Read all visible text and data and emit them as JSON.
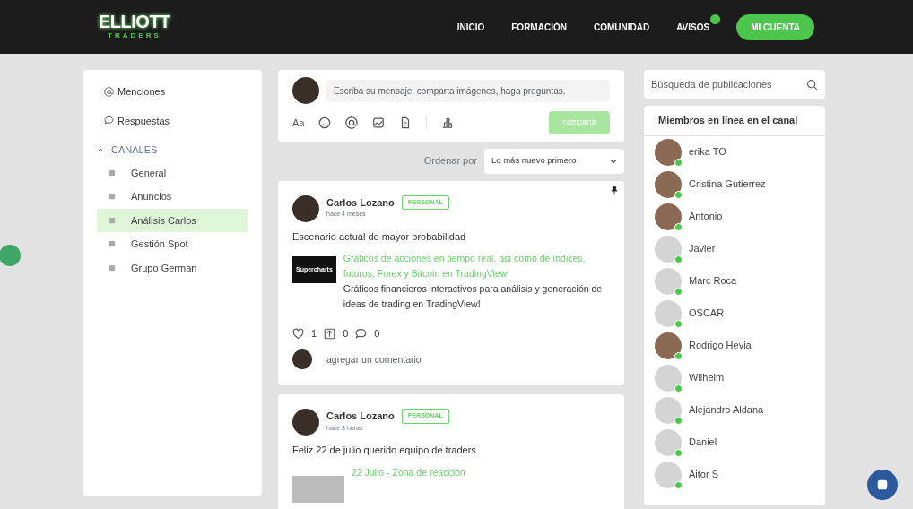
{
  "header": {
    "logo_top": "ELLIOTT",
    "logo_bottom": "TRADERS",
    "nav": [
      {
        "label": "INICIO",
        "kind": "plain"
      },
      {
        "label": "FORMACIÓN",
        "kind": "plain"
      },
      {
        "label": "COMUNIDAD",
        "kind": "plain"
      },
      {
        "label": "AVISOS",
        "kind": "badge"
      }
    ],
    "account": "MI CUENTA"
  },
  "sidebar": {
    "items": [
      {
        "label": "Menciones"
      },
      {
        "label": "Respuestas"
      }
    ],
    "section": {
      "label": "CANALES",
      "expanded": true
    },
    "channels": [
      {
        "label": "General",
        "selected": false
      },
      {
        "label": "Anuncios",
        "selected": false
      },
      {
        "label": "Análisis Carlos",
        "selected": true
      },
      {
        "label": "Gestión Spot",
        "selected": false
      },
      {
        "label": "Grupo German",
        "selected": false
      }
    ]
  },
  "composer": {
    "placeholder": "Escriba su mensaje, comparta imágenes, haga preguntas.",
    "format_label": "Aa",
    "submit": "compartir",
    "disabled": true
  },
  "sort": {
    "label": "Ordenar por",
    "value": "Lo más nuevo primero"
  },
  "posts": [
    {
      "author": "Carlos Lozano",
      "tag": "PERSONAL",
      "time": "hace 4 meses",
      "pinned": true,
      "text": "Escenario actual de mayor probabilidad",
      "link_title": "Gráficos de acciones en tiempo real, así como de índices, futuros, Forex y Bitcoin en TradingView",
      "link_desc": "Gráficos financieros interactivos para análisis y generación de ideas de trading en TradingView!",
      "thumb_label": "Supercharts",
      "likes": "1",
      "shares": "0",
      "comments": "0",
      "comment_placeholder": "agregar un comentario"
    },
    {
      "author": "Carlos Lozano",
      "tag": "PERSONAL",
      "time": "hace 3 horas",
      "pinned": false,
      "text": "Feliz 22 de julio querido equipo de traders",
      "link_title": "22 Julio - Zona de reacción"
    }
  ],
  "search": {
    "placeholder": "Búsqueda de publicaciones"
  },
  "members": {
    "title": "Miembros en línea en el canal",
    "items": [
      {
        "name": "erika TO",
        "kind": "photo",
        "online": true
      },
      {
        "name": "Cristina Gutierrez",
        "kind": "photo",
        "online": true
      },
      {
        "name": "Antonio",
        "kind": "photo",
        "online": true
      },
      {
        "name": "Javier",
        "kind": "default",
        "online": true
      },
      {
        "name": "Marc Roca",
        "kind": "default",
        "online": true
      },
      {
        "name": "OSCAR",
        "kind": "default",
        "online": true
      },
      {
        "name": "Rodrigo Hevia",
        "kind": "photo",
        "online": true
      },
      {
        "name": "Wilhelm",
        "kind": "default",
        "online": true
      },
      {
        "name": "Alejandro Aldana",
        "kind": "default",
        "online": true
      },
      {
        "name": "Daniel",
        "kind": "default",
        "online": true
      },
      {
        "name": "Aitor S",
        "kind": "default",
        "online": true
      }
    ]
  }
}
